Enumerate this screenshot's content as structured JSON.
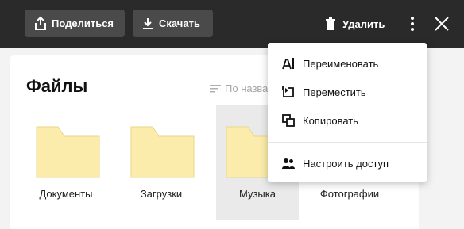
{
  "toolbar": {
    "share_label": "Поделиться",
    "download_label": "Скачать",
    "delete_label": "Удалить",
    "bg_color": "#2a2a2a",
    "button_color": "#4a4a4a"
  },
  "page": {
    "title": "Файлы",
    "sort_label": "По названию"
  },
  "folders": [
    {
      "label": "Документы",
      "icon": "folder-icon",
      "selected": false
    },
    {
      "label": "Загрузки",
      "icon": "folder-icon",
      "selected": false
    },
    {
      "label": "Музыка",
      "icon": "folder-icon",
      "selected": true
    },
    {
      "label": "Фотографии",
      "icon": "folder-icon",
      "selected": false
    }
  ],
  "menu": {
    "items": [
      {
        "label": "Переименовать",
        "icon": "rename-icon"
      },
      {
        "label": "Переместить",
        "icon": "move-icon"
      },
      {
        "label": "Копировать",
        "icon": "copy-icon"
      },
      {
        "label": "Настроить доступ",
        "icon": "people-icon"
      }
    ]
  },
  "colors": {
    "folder_fill": "#fcecab",
    "folder_stroke": "#e9d68a",
    "selected_bg": "#eaeaea"
  }
}
